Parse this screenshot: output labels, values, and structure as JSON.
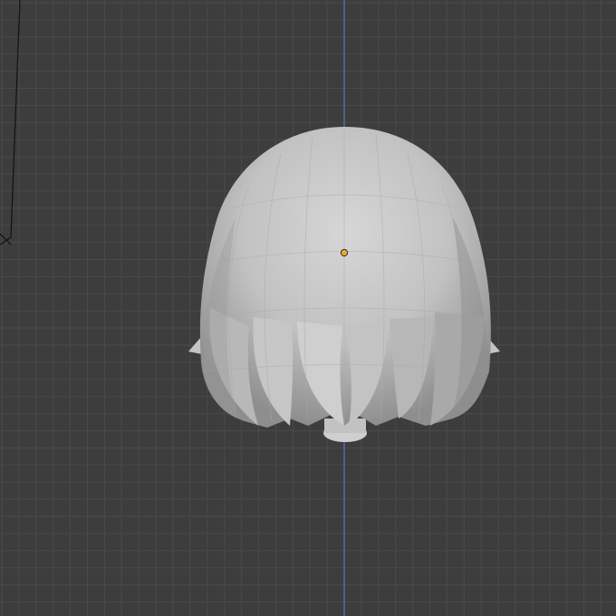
{
  "viewport": {
    "mode": "3d-viewport",
    "object": "hair-mesh",
    "shading": "solid",
    "colors": {
      "background": "#3d3d3d",
      "grid_minor": "#4a4a4a",
      "grid_major": "#555555",
      "axis_vertical": "#4f7fb8",
      "mesh_light": "#c9c9c9",
      "mesh_mid": "#b3b3b3",
      "mesh_dark": "#8f8f8f",
      "origin_dot": "#f0a830"
    }
  }
}
